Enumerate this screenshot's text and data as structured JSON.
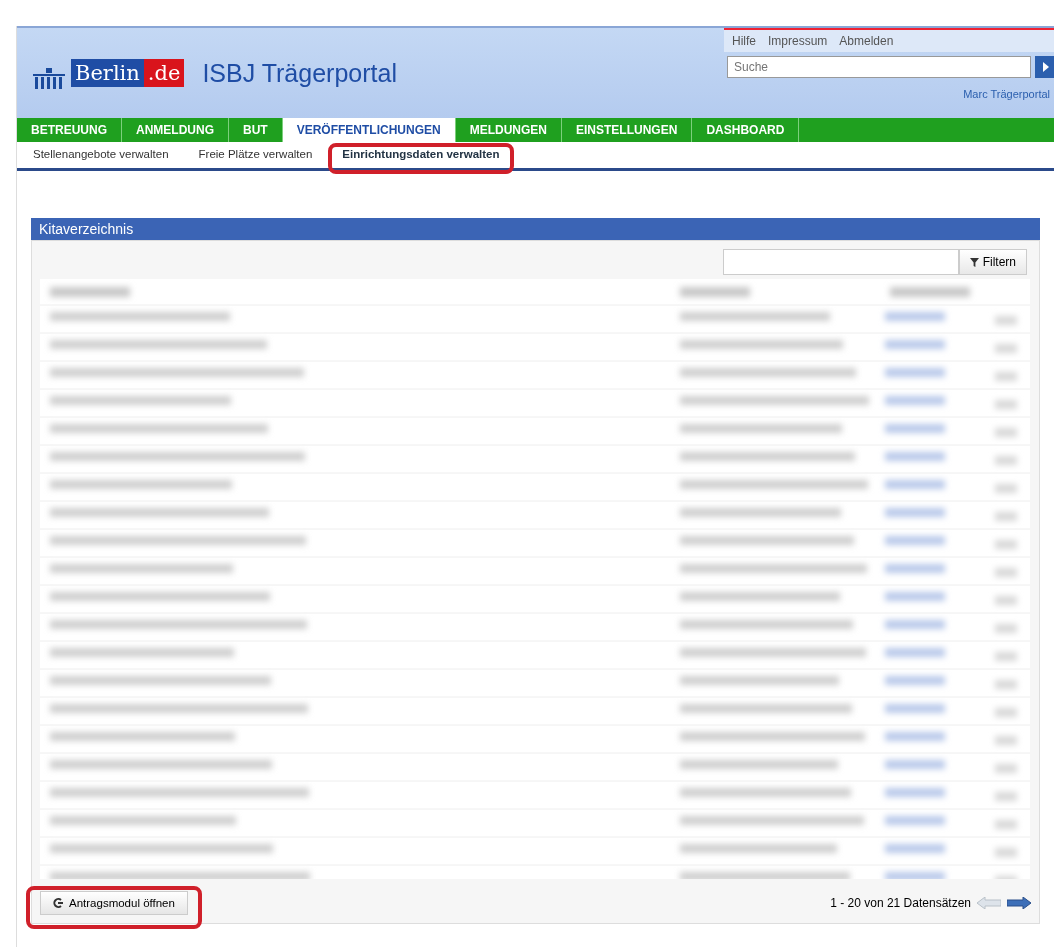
{
  "header": {
    "logo": {
      "text": "Berlin",
      "suffix": ".de"
    },
    "title": "ISBJ Trägerportal",
    "links": [
      "Hilfe",
      "Impressum",
      "Abmelden"
    ],
    "search": {
      "placeholder": "Suche"
    },
    "user": "Marc Trägerportal"
  },
  "nav": [
    {
      "label": "BETREUUNG",
      "selected": false
    },
    {
      "label": "ANMELDUNG",
      "selected": false
    },
    {
      "label": "BUT",
      "selected": false
    },
    {
      "label": "VERÖFFENTLICHUNGEN",
      "selected": true
    },
    {
      "label": "MELDUNGEN",
      "selected": false
    },
    {
      "label": "EINSTELLUNGEN",
      "selected": false
    },
    {
      "label": "DASHBOARD",
      "selected": false
    }
  ],
  "subnav": [
    {
      "label": "Stellenangebote verwalten",
      "selected": false,
      "highlighted": false
    },
    {
      "label": "Freie Plätze verwalten",
      "selected": false,
      "highlighted": false
    },
    {
      "label": "Einrichtungsdaten verwalten",
      "selected": true,
      "highlighted": true
    }
  ],
  "panel": {
    "title": "Kitaverzeichnis",
    "filter_button": "Filtern",
    "table": {
      "kind": "blurred"
    },
    "action_button": {
      "label": "Antragsmodul öffnen",
      "highlighted": true
    },
    "pagination": "1 - 20 von 21 Datensätzen"
  }
}
